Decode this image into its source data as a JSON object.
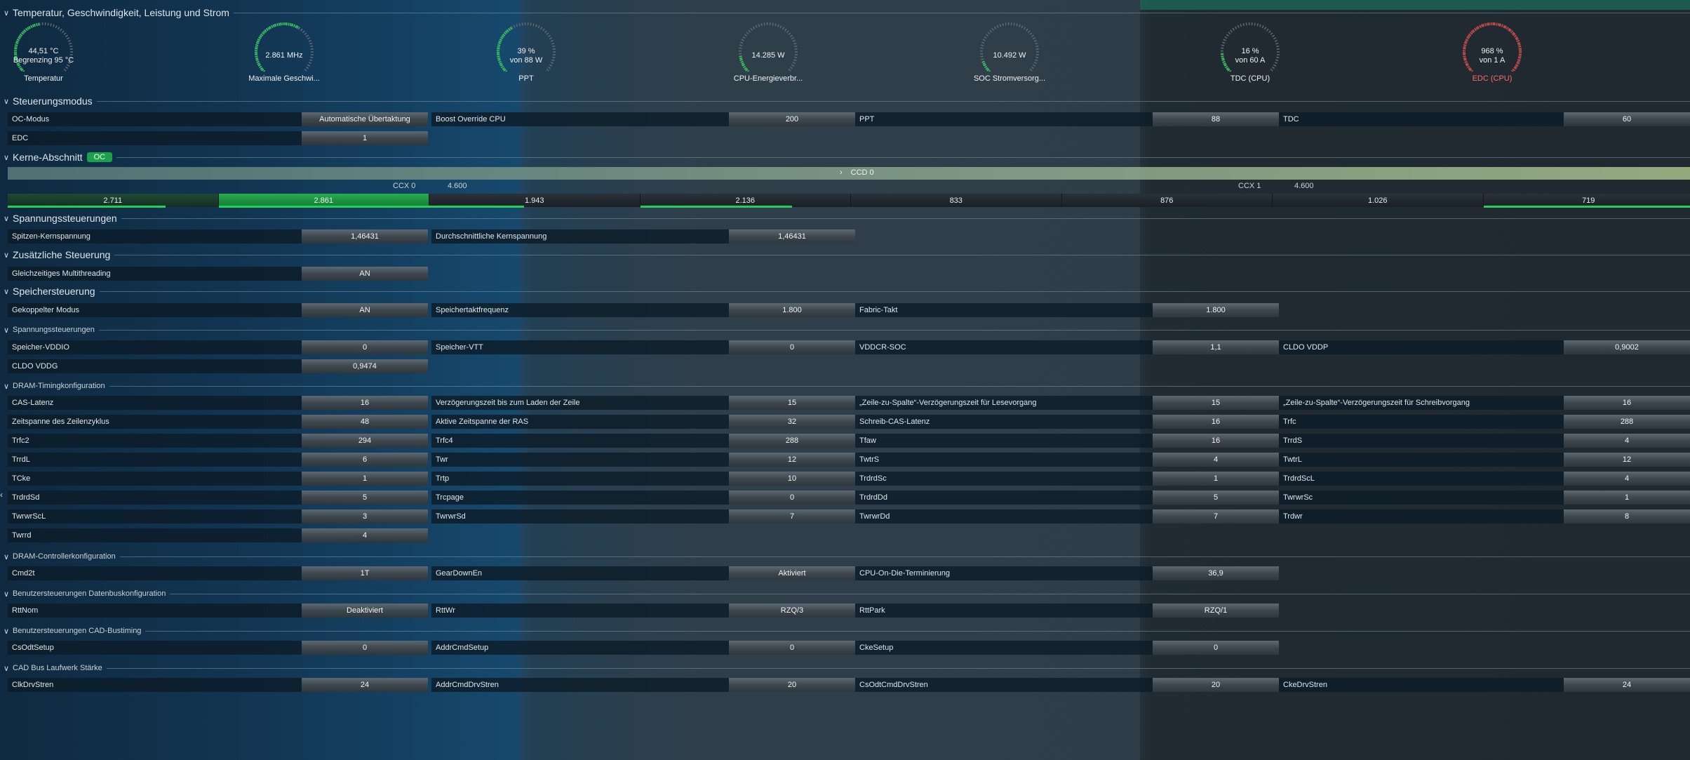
{
  "sections": {
    "temp": "Temperatur, Geschwindigkeit, Leistung und Strom",
    "control": "Steuerungsmodus",
    "cores": "Kerne-Abschnitt",
    "cores_badge": "OC",
    "voltage": "Spannungssteuerungen",
    "additional": "Zusätzliche Steuerung",
    "memory": "Speichersteuerung",
    "mem_voltage": "Spannungssteuerungen",
    "dram_timing": "DRAM-Timingkonfiguration",
    "dram_ctrl": "DRAM-Controllerkonfiguration",
    "databus": "Benutzersteuerungen Datenbuskonfiguration",
    "cad_timing": "Benutzersteuerungen CAD-Bustiming",
    "cad_strength": "CAD Bus Laufwerk Stärke"
  },
  "gauges": [
    {
      "line1": "44,51 °C",
      "line2": "Begrenzing 95 °C",
      "label": "Temperatur",
      "fraction": 0.47,
      "color": "#2fcf5b"
    },
    {
      "line1": "2.861  MHz",
      "line2": "",
      "label": "Maximale Geschwi...",
      "fraction": 0.62,
      "color": "#2fcf5b"
    },
    {
      "line1": "39 %",
      "line2": "von 88 W",
      "label": "PPT",
      "fraction": 0.39,
      "color": "#2fcf5b"
    },
    {
      "line1": "14.285 W",
      "line2": "",
      "label": "CPU-Energieverbr...",
      "fraction": 0.14,
      "color": "#2fcf5b"
    },
    {
      "line1": "10.492 W",
      "line2": "",
      "label": "SOC Stromversorg...",
      "fraction": 0.1,
      "color": "#2fcf5b"
    },
    {
      "line1": "16 %",
      "line2": "von 60 A",
      "label": "TDC (CPU)",
      "fraction": 0.16,
      "color": "#2fcf5b"
    },
    {
      "line1": "968 %",
      "line2": "von 1 A",
      "label": "EDC (CPU)",
      "fraction": 1.0,
      "color": "#e0403c"
    }
  ],
  "control": [
    {
      "label": "OC-Modus",
      "value": "Automatische Übertaktung"
    },
    {
      "label": "Boost Override CPU",
      "value": "200"
    },
    {
      "label": "PPT",
      "value": "88"
    },
    {
      "label": "TDC",
      "value": "60"
    },
    {
      "label": "EDC",
      "value": "1"
    }
  ],
  "ccd": {
    "title": "CCD 0",
    "chevron": "›"
  },
  "ccx": [
    {
      "name": "CCX 0",
      "freq": "4.600"
    },
    {
      "name": "CCX 1",
      "freq": "4.600"
    }
  ],
  "cores": [
    "2.711",
    "2.861",
    "1.943",
    "2.136",
    "833",
    "876",
    "1.026",
    "719"
  ],
  "voltage": [
    {
      "label": "Spitzen-Kernspannung",
      "value": "1,46431"
    },
    {
      "label": "Durchschnittliche Kernspannung",
      "value": "1,46431"
    }
  ],
  "additional": [
    {
      "label": "Gleichzeitiges Multithreading",
      "value": "AN"
    }
  ],
  "memory": [
    {
      "label": "Gekoppelter Modus",
      "value": "AN"
    },
    {
      "label": "Speichertaktfrequenz",
      "value": "1.800"
    },
    {
      "label": "Fabric-Takt",
      "value": "1.800"
    }
  ],
  "mem_voltage": [
    {
      "label": "Speicher-VDDIO",
      "value": "0"
    },
    {
      "label": "Speicher-VTT",
      "value": "0"
    },
    {
      "label": "VDDCR-SOC",
      "value": "1,1"
    },
    {
      "label": "CLDO VDDP",
      "value": "0,9002"
    },
    {
      "label": "CLDO VDDG",
      "value": "0,9474"
    }
  ],
  "dram_timing": [
    {
      "label": "CAS-Latenz",
      "value": "16"
    },
    {
      "label": "Verzögerungszeit bis zum Laden der Zeile",
      "value": "15"
    },
    {
      "label": "„Zeile-zu-Spalte“-Verzögerungszeit für Lesevorgang",
      "value": "15"
    },
    {
      "label": "„Zeile-zu-Spalte“-Verzögerungszeit für Schreibvorgang",
      "value": "16"
    },
    {
      "label": "Zeitspanne des Zeilenzyklus",
      "value": "48"
    },
    {
      "label": "Aktive Zeitspanne der RAS",
      "value": "32"
    },
    {
      "label": "Schreib-CAS-Latenz",
      "value": "16"
    },
    {
      "label": "Trfc",
      "value": "288"
    },
    {
      "label": "Trfc2",
      "value": "294"
    },
    {
      "label": "Trfc4",
      "value": "288"
    },
    {
      "label": "Tfaw",
      "value": "16"
    },
    {
      "label": "TrrdS",
      "value": "4"
    },
    {
      "label": "TrrdL",
      "value": "6"
    },
    {
      "label": "Twr",
      "value": "12"
    },
    {
      "label": "TwtrS",
      "value": "4"
    },
    {
      "label": "TwtrL",
      "value": "12"
    },
    {
      "label": "TCke",
      "value": "1"
    },
    {
      "label": "Trtp",
      "value": "10"
    },
    {
      "label": "TrdrdSc",
      "value": "1"
    },
    {
      "label": "TrdrdScL",
      "value": "4"
    },
    {
      "label": "TrdrdSd",
      "value": "5"
    },
    {
      "label": "Trcpage",
      "value": "0"
    },
    {
      "label": "TrdrdDd",
      "value": "5"
    },
    {
      "label": "TwrwrSc",
      "value": "1"
    },
    {
      "label": "TwrwrScL",
      "value": "3"
    },
    {
      "label": "TwrwrSd",
      "value": "7"
    },
    {
      "label": "TwrwrDd",
      "value": "7"
    },
    {
      "label": "Trdwr",
      "value": "8"
    },
    {
      "label": "Twrrd",
      "value": "4"
    }
  ],
  "dram_ctrl": [
    {
      "label": "Cmd2t",
      "value": "1T"
    },
    {
      "label": "GearDownEn",
      "value": "Aktiviert"
    },
    {
      "label": "CPU-On-Die-Terminierung",
      "value": "36,9"
    }
  ],
  "databus": [
    {
      "label": "RttNom",
      "value": "Deaktiviert"
    },
    {
      "label": "RttWr",
      "value": "RZQ/3"
    },
    {
      "label": "RttPark",
      "value": "RZQ/1"
    }
  ],
  "cad_timing": [
    {
      "label": "CsOdtSetup",
      "value": "0"
    },
    {
      "label": "AddrCmdSetup",
      "value": "0"
    },
    {
      "label": "CkeSetup",
      "value": "0"
    }
  ],
  "cad_strength": [
    {
      "label": "ClkDrvStren",
      "value": "24"
    },
    {
      "label": "AddrCmdDrvStren",
      "value": "20"
    },
    {
      "label": "CsOdtCmdDrvStren",
      "value": "20"
    },
    {
      "label": "CkeDrvStren",
      "value": "24"
    }
  ],
  "side_arrow": "‹"
}
